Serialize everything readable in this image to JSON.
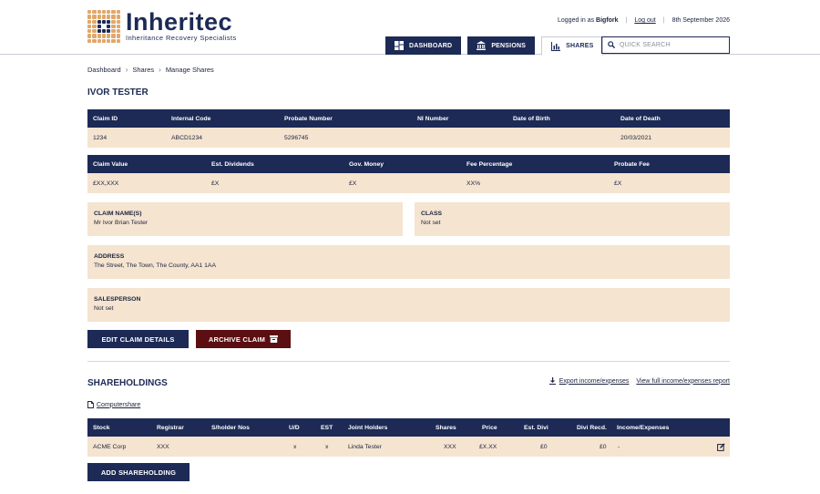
{
  "brand": {
    "name": "Inheritec",
    "tagline": "Inheritance Recovery Specialists"
  },
  "session": {
    "logged_in_prefix": "Logged in as",
    "user": "Bigfork",
    "logout": "Log out",
    "date": "8th September 2026"
  },
  "nav": [
    {
      "label": "DASHBOARD",
      "icon": "dashboard-icon"
    },
    {
      "label": "PENSIONS",
      "icon": "bank-icon"
    },
    {
      "label": "SHARES",
      "icon": "bar-chart-icon",
      "active": true
    }
  ],
  "search": {
    "placeholder": "QUICK SEARCH"
  },
  "breadcrumb": [
    "Dashboard",
    "Shares",
    "Manage Shares"
  ],
  "page_title": "IVOR TESTER",
  "claim_table_1": {
    "headers": [
      "Claim ID",
      "Internal Code",
      "Probate Number",
      "NI Number",
      "Date of Birth",
      "Date of Death"
    ],
    "values": [
      "1234",
      "ABCD1234",
      "5296745",
      "",
      "",
      "20/03/2021"
    ]
  },
  "claim_table_2": {
    "headers": [
      "Claim Value",
      "Est. Dividends",
      "Gov. Money",
      "Fee Percentage",
      "Probate Fee"
    ],
    "values": [
      "£XX,XXX",
      "£X",
      "£X",
      "XX%",
      "£X"
    ]
  },
  "panels": {
    "claim_names": {
      "label": "CLAIM NAME(S)",
      "value": "Mr Ivor Brian Tester"
    },
    "class": {
      "label": "CLASS",
      "value": "Not set"
    },
    "address": {
      "label": "ADDRESS",
      "value": "The Street, The Town, The County, AA1 1AA"
    },
    "salesperson": {
      "label": "SALESPERSON",
      "value": "Not set"
    }
  },
  "actions": {
    "edit": "EDIT CLAIM DETAILS",
    "archive": "ARCHIVE CLAIM"
  },
  "shareholdings": {
    "title": "SHAREHOLDINGS",
    "export_link": "Export income/expenses",
    "report_link": "View full income/expenses report",
    "registrar_link": "Computershare",
    "headers": [
      "Stock",
      "Registrar",
      "S/holder Nos",
      "U/D",
      "EST",
      "Joint Holders",
      "Shares",
      "Price",
      "Est. Divi",
      "Divi Recd.",
      "Income/Expenses"
    ],
    "rows": [
      [
        "ACME Corp",
        "XXX",
        "",
        "x",
        "x",
        "Linda Tester",
        "XXX",
        "£X.XX",
        "£0",
        "£0",
        "-"
      ]
    ],
    "add_button": "ADD SHAREHOLDING"
  },
  "colors": {
    "navy": "#1c2a55",
    "sand": "#f5e4cf",
    "maroon": "#5b0f12",
    "gold": "#e0a86b"
  }
}
